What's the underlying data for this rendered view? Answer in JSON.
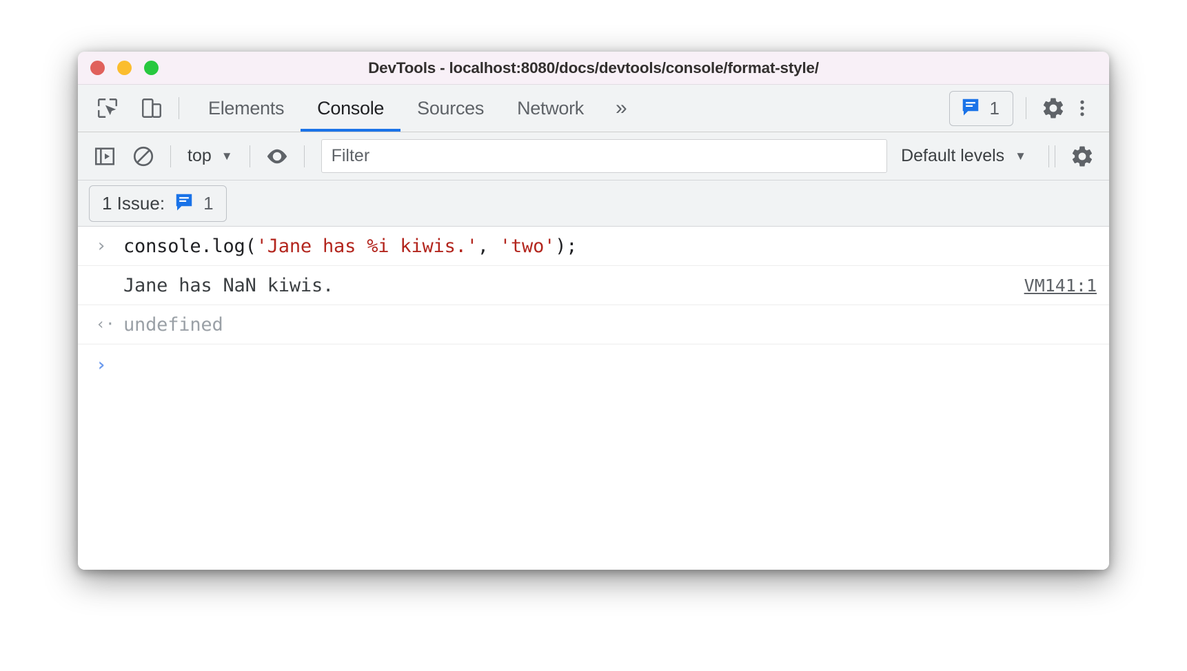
{
  "window": {
    "title": "DevTools - localhost:8080/docs/devtools/console/format-style/",
    "traffic_lights": [
      {
        "name": "close",
        "color": "#e0615c"
      },
      {
        "name": "minimize",
        "color": "#fbbd2e"
      },
      {
        "name": "zoom",
        "color": "#28c83f"
      }
    ]
  },
  "tabbar": {
    "icons": [
      {
        "name": "inspect-element-icon"
      },
      {
        "name": "device-toolbar-icon"
      }
    ],
    "tabs": [
      {
        "label": "Elements",
        "active": false
      },
      {
        "label": "Console",
        "active": true
      },
      {
        "label": "Sources",
        "active": false
      },
      {
        "label": "Network",
        "active": false
      }
    ],
    "more_tabs": "»",
    "issues_chip": {
      "icon": "issues-bubble-icon",
      "count": "1",
      "icon_color": "#1a73e8"
    },
    "settings_icon": "gear-icon",
    "menu_icon": "kebab-menu-icon"
  },
  "console_toolbar": {
    "sidebar_toggle_icon": "console-sidebar-icon",
    "clear_icon": "clear-console-icon",
    "context": {
      "label": "top",
      "caret": "▼"
    },
    "live_expression_icon": "eye-icon",
    "filter": {
      "value": "",
      "placeholder": "Filter"
    },
    "levels": {
      "label": "Default levels",
      "caret": "▼"
    },
    "settings_icon": "gear-icon"
  },
  "issues_bar": {
    "label": "1 Issue:",
    "icon": "issues-bubble-icon",
    "count": "1"
  },
  "console": {
    "rows": [
      {
        "type": "command",
        "gutter": "›",
        "code_parts": [
          {
            "text": "console.log(",
            "kind": "plain"
          },
          {
            "text": "'Jane has %i kiwis.'",
            "kind": "string"
          },
          {
            "text": ", ",
            "kind": "plain"
          },
          {
            "text": "'two'",
            "kind": "string"
          },
          {
            "text": ");",
            "kind": "plain"
          }
        ]
      },
      {
        "type": "output",
        "gutter": "",
        "text": "Jane has NaN kiwis.",
        "source": "VM141:1"
      },
      {
        "type": "return",
        "gutter": "‹·",
        "text": "undefined"
      },
      {
        "type": "prompt",
        "gutter": "›",
        "text": ""
      }
    ]
  },
  "colors": {
    "accent": "#1a73e8",
    "titlebar_bg": "#f8f0f7",
    "toolbar_bg": "#f1f3f4",
    "string_red": "#b3261e",
    "prompt_blue": "#6b9aee"
  }
}
